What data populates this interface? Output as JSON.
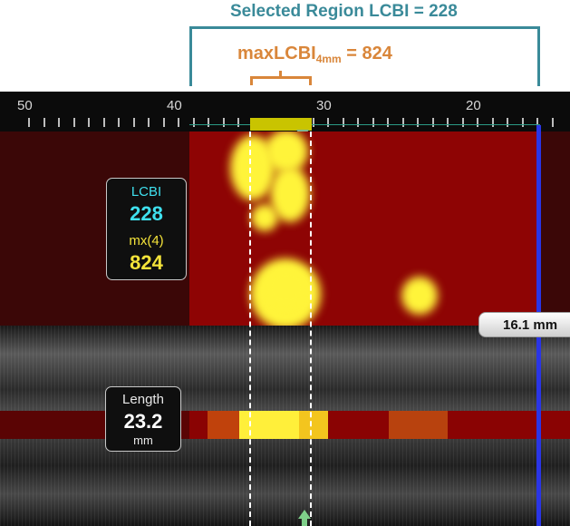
{
  "annotation": {
    "selected_region": "Selected Region LCBI = 228",
    "max_lcbi_main": "maxLCBI",
    "max_lcbi_sub": "4mm",
    "max_lcbi_value": " = 824"
  },
  "ruler": {
    "labels": [
      "50",
      "40",
      "30",
      "20"
    ]
  },
  "lcbi_box": {
    "lcbi_label": "LCBI",
    "lcbi_value": "228",
    "mx_label": "mx(4)",
    "mx_value": "824"
  },
  "length_box": {
    "label": "Length",
    "value": "23.2",
    "unit": "mm"
  },
  "distance_tag": "16.1 mm",
  "colors": {
    "teal_annotation": "#3a8a99",
    "orange_annotation": "#d9863a",
    "lipid_yellow": "#fff43a",
    "chemogram_red": "#8e0404",
    "cursor_blue": "#2a35e6"
  }
}
